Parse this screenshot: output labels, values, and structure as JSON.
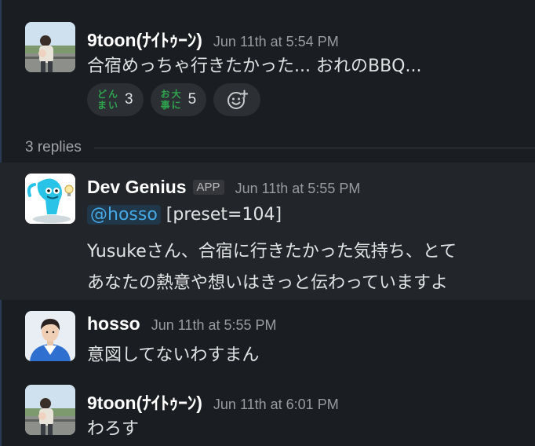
{
  "thread": {
    "parent": {
      "author": "9toon(ﾅｲﾄｩｰﾝ)",
      "timestamp": "Jun 11th at 5:54 PM",
      "text": "合宿めっちゃ行きたかった... おれのBBQ...",
      "reactions": [
        {
          "emoji": "donmai",
          "emoji_text": [
            "ど",
            "ん",
            "ま",
            "い"
          ],
          "count": "3"
        },
        {
          "emoji": "odaijini",
          "emoji_text": [
            "お",
            "大",
            "事",
            "に"
          ],
          "count": "5"
        }
      ]
    },
    "replies_label": "3 replies",
    "replies": [
      {
        "author": "Dev Genius",
        "badge": "APP",
        "timestamp": "Jun 11th at 5:55 PM",
        "mention": "@hosso",
        "line1_rest": " [preset=104]",
        "line2": "Yusukeさん、合宿に行きたかった気持ち、とて",
        "line3": "あなたの熱意や想いはきっと伝わっていますよ"
      },
      {
        "author": "hosso",
        "timestamp": "Jun 11th at 5:55 PM",
        "text": "意図してないわすまん"
      },
      {
        "author": "9toon(ﾅｲﾄｩｰﾝ)",
        "timestamp": "Jun 11th at 6:01 PM",
        "text": "わろす"
      }
    ]
  },
  "colors": {
    "background": "#1a1d21",
    "highlight": "#222529",
    "mention": "#46a9e6",
    "emoji_green": "#2ea44f"
  }
}
